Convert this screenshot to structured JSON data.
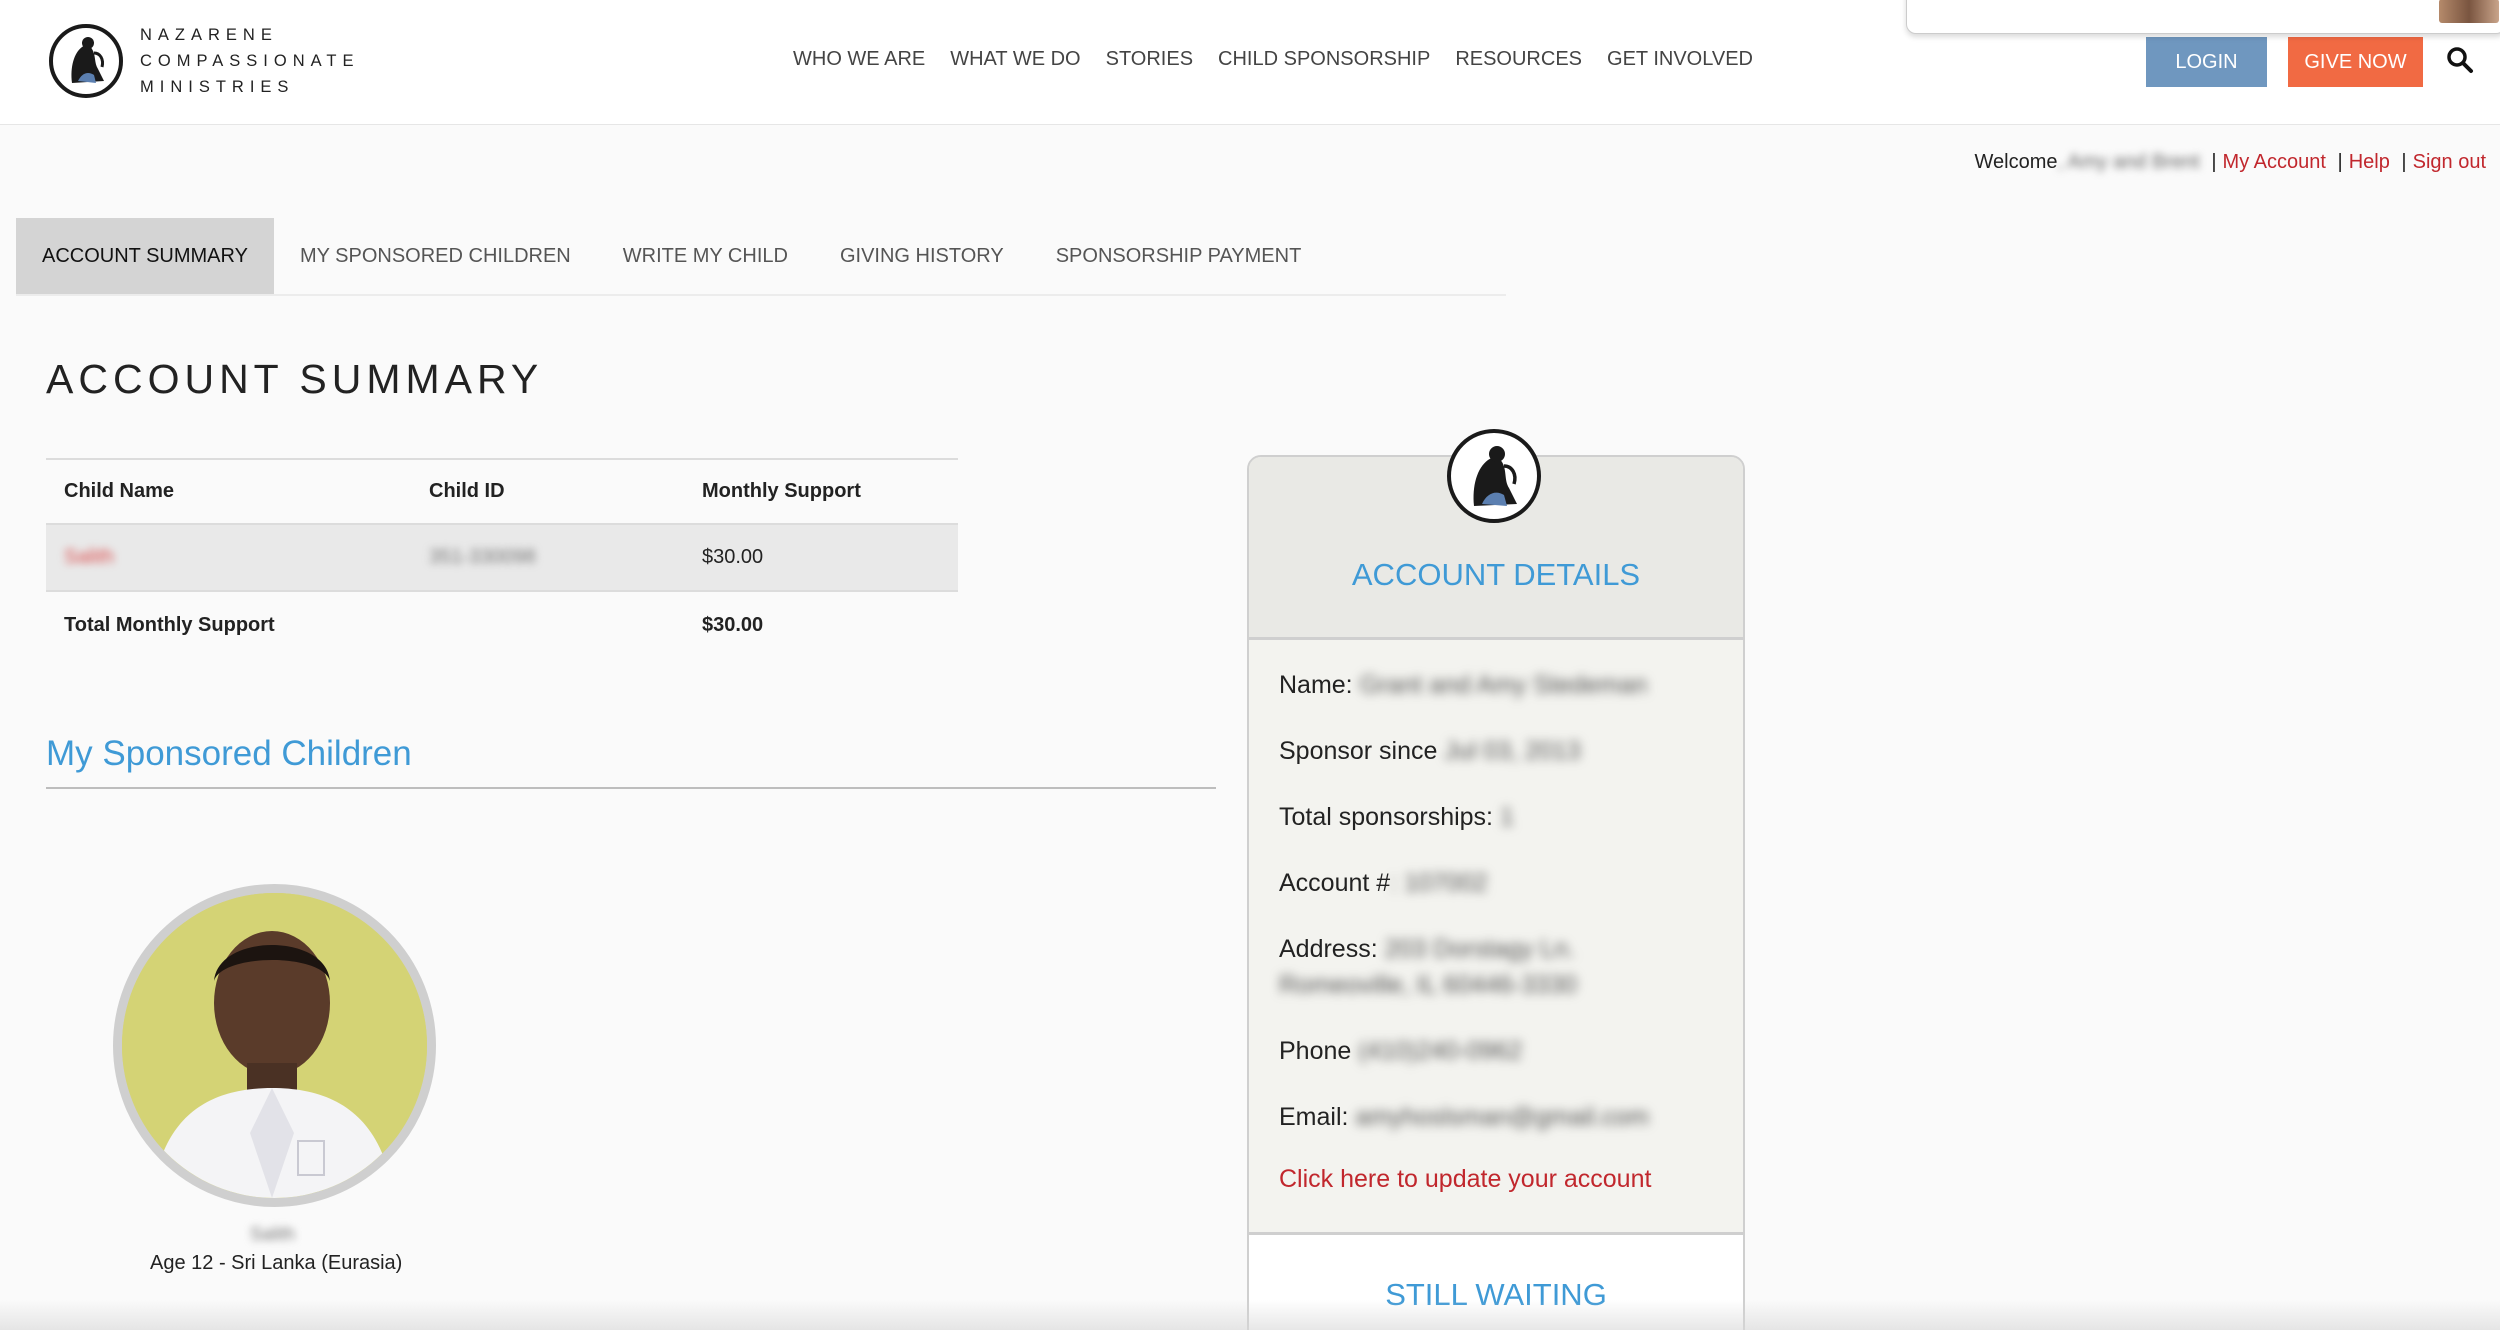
{
  "brand": {
    "lines": [
      "NAZARENE",
      "COMPASSIONATE",
      "MINISTRIES"
    ]
  },
  "nav": [
    "WHO WE ARE",
    "WHAT WE DO",
    "STORIES",
    "CHILD SPONSORSHIP",
    "RESOURCES",
    "GET INVOLVED"
  ],
  "header": {
    "login_label": "LOGIN",
    "give_label": "GIVE NOW"
  },
  "welcome": {
    "prefix": "Welcome",
    "name": ", Amy and Brent",
    "links": [
      "My Account",
      "Help",
      "Sign out"
    ]
  },
  "tabs": [
    "ACCOUNT SUMMARY",
    "MY SPONSORED CHILDREN",
    "WRITE MY CHILD",
    "GIVING HISTORY",
    "SPONSORSHIP PAYMENT"
  ],
  "page_title": "ACCOUNT SUMMARY",
  "summary": {
    "headers": [
      "Child Name",
      "Child ID",
      "Monthly Support"
    ],
    "row": {
      "name": "Salith",
      "id": "351-330098",
      "amount": "$30.00"
    },
    "total_label": "Total Monthly Support",
    "total_amount": "$30.00"
  },
  "sponsored": {
    "title": "My Sponsored Children",
    "child_name": "Salith",
    "child_caption": "Age 12 - Sri Lanka (Eurasia)"
  },
  "account": {
    "title": "ACCOUNT DETAILS",
    "name_label": "Name:",
    "name_value": "Grant and Amy Stedeman",
    "since_label": "Sponsor since",
    "since_value": " Jul 03, 2013",
    "total_label": "Total sponsorships:",
    "total_value": "1",
    "account_label": "Account #",
    "account_value": ": 107002",
    "address_label": "Address:",
    "address_line1": "203 Dorstagy Ln.",
    "address_line2": "Romeoville, IL 60446-3330",
    "phone_label": "Phone",
    "phone_value": " (410)240-0962",
    "email_label": "Email:",
    "email_value": "amyhoslsman@gmail.com",
    "update_link": "Click here to update your account",
    "waiting_title": "STILL WAITING"
  },
  "colors": {
    "accent_blue": "#3f9ad6",
    "link_red": "#c1272d",
    "login_bg": "#6f97bf",
    "give_bg": "#f16a43"
  }
}
